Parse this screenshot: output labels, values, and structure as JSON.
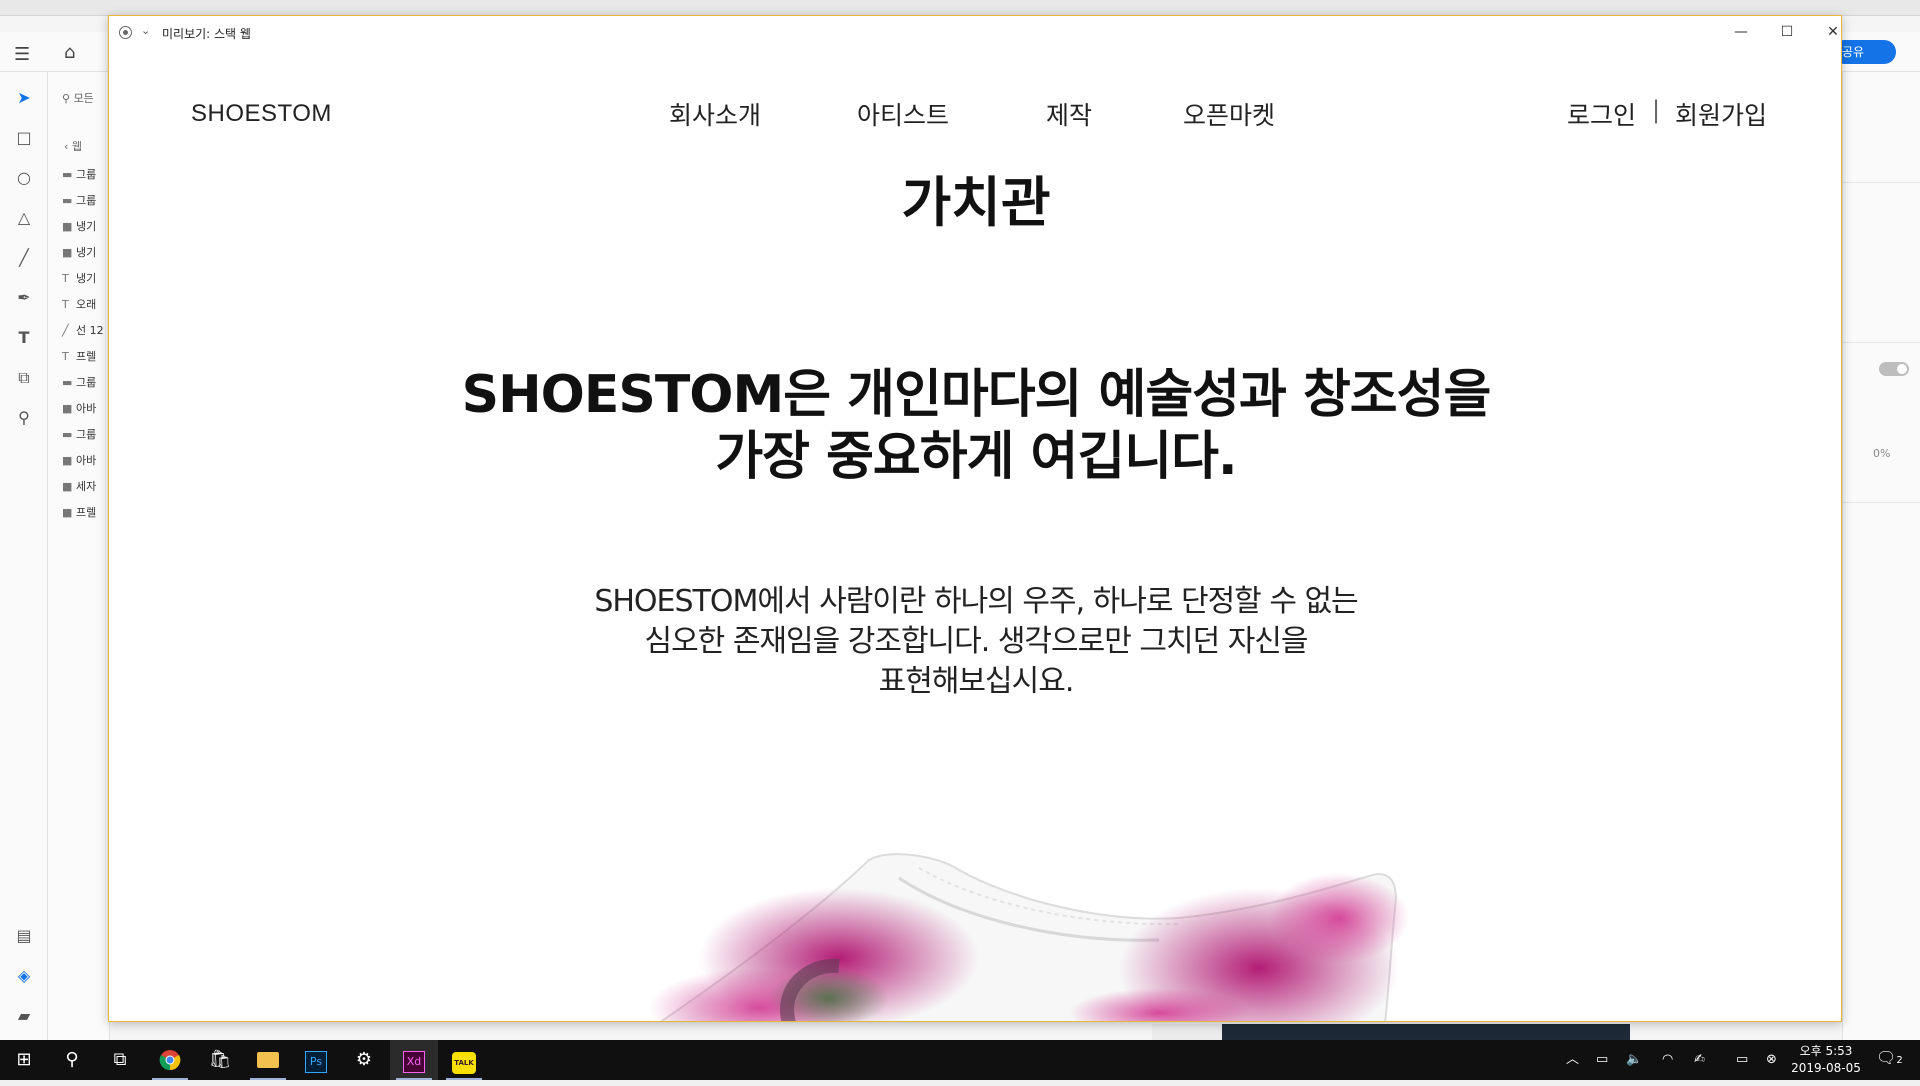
{
  "background_app": {
    "share_label": "공유",
    "search_placeholder": "모든",
    "back_label": "웹",
    "layers": [
      {
        "icon": "folder",
        "label": "그룹"
      },
      {
        "icon": "folder",
        "label": "그룹"
      },
      {
        "icon": "rect",
        "label": "냉기"
      },
      {
        "icon": "rect",
        "label": "냉기"
      },
      {
        "icon": "text",
        "label": "냉기"
      },
      {
        "icon": "text",
        "label": "오래"
      },
      {
        "icon": "line",
        "label": "선 12"
      },
      {
        "icon": "text",
        "label": "프렐"
      },
      {
        "icon": "folder",
        "label": "그룹"
      },
      {
        "icon": "rect",
        "label": "아바"
      },
      {
        "icon": "folder",
        "label": "그룹"
      },
      {
        "icon": "rect",
        "label": "아바"
      },
      {
        "icon": "rect",
        "label": "세자"
      },
      {
        "icon": "rect",
        "label": "프렐"
      }
    ],
    "opacity_value": "0%"
  },
  "preview_window": {
    "title": "미리보기: 스택 웹"
  },
  "site": {
    "logo": "SHOESTOM",
    "nav": [
      "회사소개",
      "아티스트",
      "제작",
      "오픈마켓"
    ],
    "login": "로그인",
    "separator": "|",
    "signup": "회원가입",
    "heading": "가치관",
    "statement_line1": "SHOESTOM은 개인마다의 예술성과 창조성을",
    "statement_line2": "가장 중요하게 여깁니다.",
    "body_line1": "SHOESTOM에서 사람이란 하나의 우주, 하나로 단정할 수 없는",
    "body_line2": "심오한 존재임을 강조합니다. 생각으로만 그치던 자신을",
    "body_line3": "표현해보십시요."
  },
  "taskbar": {
    "apps": [
      "start",
      "search",
      "task-view",
      "chrome",
      "store",
      "file-explorer",
      "photoshop",
      "settings",
      "adobe-xd",
      "kakaotalk"
    ],
    "ps_label": "Ps",
    "xd_label": "Xd",
    "talk_label": "TALK",
    "time": "오후 5:53",
    "date": "2019-08-05",
    "notification_count": "2"
  },
  "colors": {
    "accent": "#1473e6",
    "window_border": "#e7b73b",
    "xd_brand": "#470137",
    "ps_brand": "#001e36",
    "kakao_yellow": "#f9e000"
  }
}
